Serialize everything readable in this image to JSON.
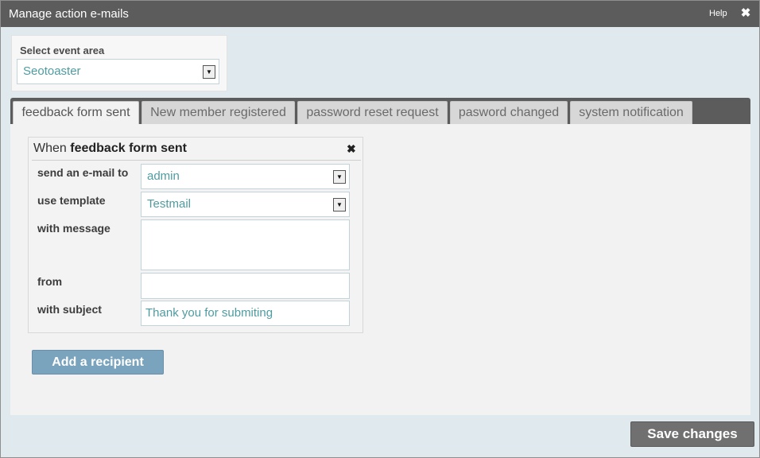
{
  "window": {
    "title": "Manage action e-mails",
    "help_label": "Help",
    "close_glyph": "✖"
  },
  "event_area": {
    "label": "Select event area",
    "selected": "Seotoaster"
  },
  "tabs": [
    {
      "label": "feedback form sent",
      "active": true
    },
    {
      "label": "New member registered",
      "active": false
    },
    {
      "label": "password reset request",
      "active": false
    },
    {
      "label": "pasword changed",
      "active": false
    },
    {
      "label": "system notification",
      "active": false
    }
  ],
  "rule": {
    "heading_prefix": "When",
    "heading_event": "feedback form sent",
    "close_glyph": "✖",
    "fields": {
      "send_to": {
        "label": "send an e-mail to",
        "value": "admin"
      },
      "template": {
        "label": "use template",
        "value": "Testmail"
      },
      "message": {
        "label": "with message",
        "value": ""
      },
      "from": {
        "label": "from",
        "value": ""
      },
      "subject": {
        "label": "with subject",
        "value": "Thank you for submiting"
      }
    }
  },
  "buttons": {
    "add_recipient": "Add a recipient",
    "save_changes": "Save changes"
  },
  "icons": {
    "dropdown_arrow": "▼"
  },
  "colors": {
    "titlebar": "#5c5c5c",
    "accent_text": "#4f9ca0",
    "add_button": "#7aa4bd",
    "save_button": "#707070"
  }
}
